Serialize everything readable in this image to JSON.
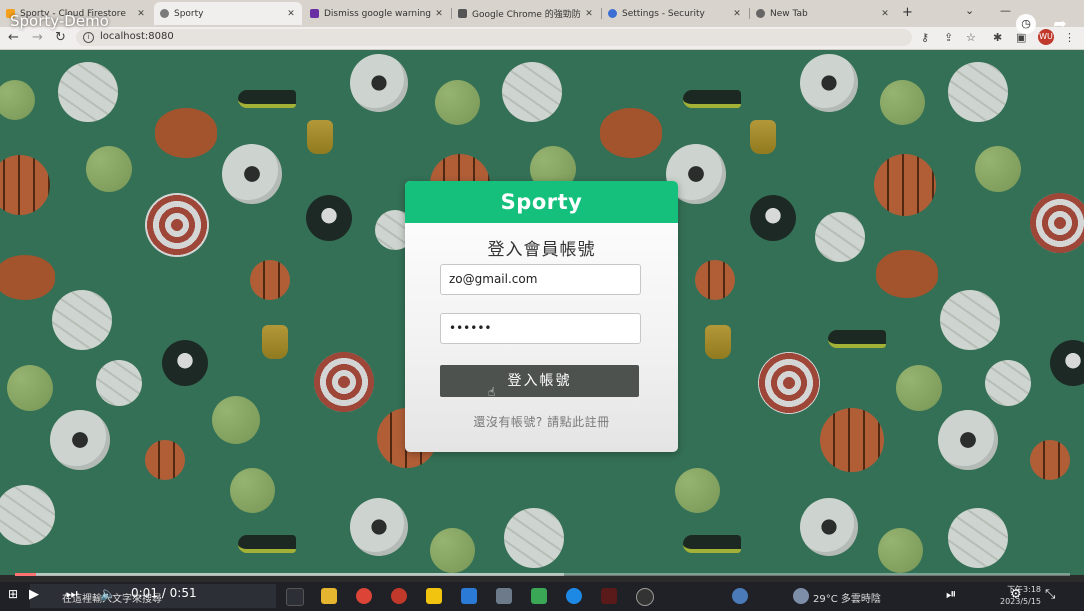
{
  "video": {
    "title": "Sporty-Demo",
    "current_time": "0:01",
    "duration": "0:51",
    "time_separator": "/",
    "progress_fraction": 0.02,
    "buffered_fraction": 0.52
  },
  "browser": {
    "tabs": [
      {
        "label": "Sporty - Cloud Firestore",
        "active": false,
        "color": "#f4a01c"
      },
      {
        "label": "Sporty",
        "active": true,
        "color": "#7a7a7a"
      },
      {
        "label": "Dismiss google warning -",
        "active": false,
        "color": "#6b2fa4"
      },
      {
        "label": "Google Chrome 的強勁防",
        "active": false,
        "color": "#555555"
      },
      {
        "label": "Settings - Security",
        "active": false,
        "color": "#3b6fd4"
      },
      {
        "label": "New Tab",
        "active": false,
        "color": "#666666"
      }
    ],
    "url": "localhost:8080",
    "profile_initials": "WU"
  },
  "login": {
    "brand": "Sporty",
    "title": "登入會員帳號",
    "email_value": "zo@gmail.com",
    "password_value": "••••••",
    "submit_label": "登入帳號",
    "signup_link": "還沒有帳號? 請點此註冊"
  },
  "taskbar": {
    "search_text": "在這裡輸入文字來搜尋",
    "weather": "29°C  多雲時陰",
    "time": "下午3:18",
    "date": "2023/5/15"
  },
  "colors": {
    "brand_green": "#14c07c",
    "button_dark": "#4d524f",
    "pattern_green": "#3a7a5e",
    "progress_red": "#ff0000"
  }
}
